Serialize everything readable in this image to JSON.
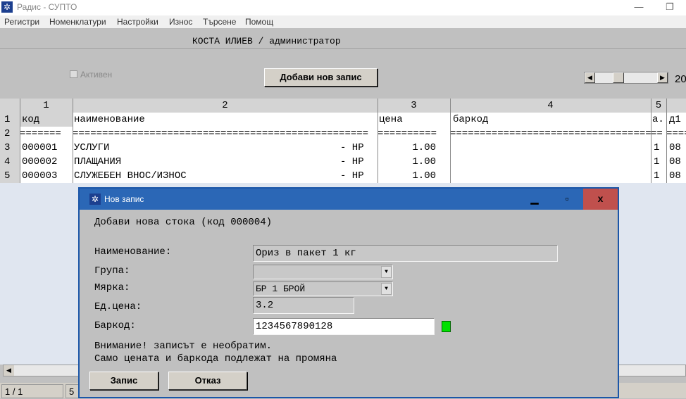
{
  "window": {
    "title": "Радис - СУПТО"
  },
  "menu": [
    "Регистри",
    "Номенклатури",
    "Настройки",
    "Износ",
    "Търсене",
    "Помощ"
  ],
  "toolbar": {
    "user_line": "КОСТА ИЛИЕВ / администратор",
    "active_label": "Активен",
    "add_button": "Добави нов запис",
    "year_fragment": "20"
  },
  "grid": {
    "col_numbers": [
      "1",
      "2",
      "3",
      "4",
      "5",
      ""
    ],
    "headers": [
      "код",
      "наименование",
      "цена",
      "баркод",
      "а.",
      "д1"
    ],
    "row_numbers": [
      "1",
      "2",
      "3",
      "4",
      "5"
    ],
    "separator_row": [
      "=======",
      "==================================================",
      "==========",
      "==========================================",
      "==",
      "===="
    ],
    "rows": [
      {
        "code": "000001",
        "name": "УСЛУГИ",
        "suffix": "- НР",
        "price": "1.00",
        "barcode": "",
        "a": "1",
        "d1": "08"
      },
      {
        "code": "000002",
        "name": "ПЛАЩАНИЯ",
        "suffix": "- НР",
        "price": "1.00",
        "barcode": "",
        "a": "1",
        "d1": "08"
      },
      {
        "code": "000003",
        "name": "СЛУЖЕБЕН ВНОС/ИЗНОС",
        "suffix": "- НР",
        "price": "1.00",
        "barcode": "",
        "a": "1",
        "d1": "08"
      }
    ]
  },
  "status": {
    "page": "1 / 1",
    "cell2": "5"
  },
  "dialog": {
    "title": "Нов запис",
    "heading": "Добави нова стока (код 000004)",
    "labels": {
      "name": "Наименование:",
      "group": "Група:",
      "unit": "Мярка:",
      "unit_price": "Ед.цена:",
      "barcode": "Баркод:"
    },
    "values": {
      "name": "Ориз в пакет 1 кг",
      "group": "",
      "unit": "БР 1 БРОЙ",
      "unit_price": "3.2",
      "barcode": "1234567890128"
    },
    "warning_1": "Внимание! записът е необратим.",
    "warning_2": "Само цената и баркода подлежат на промяна",
    "save_button": "Запис",
    "cancel_button": "Отказ",
    "close_symbol": "x"
  },
  "colors": {
    "dialog_title": "#2b67b6",
    "close_button": "#c0504d",
    "indicator": "#00e000"
  }
}
